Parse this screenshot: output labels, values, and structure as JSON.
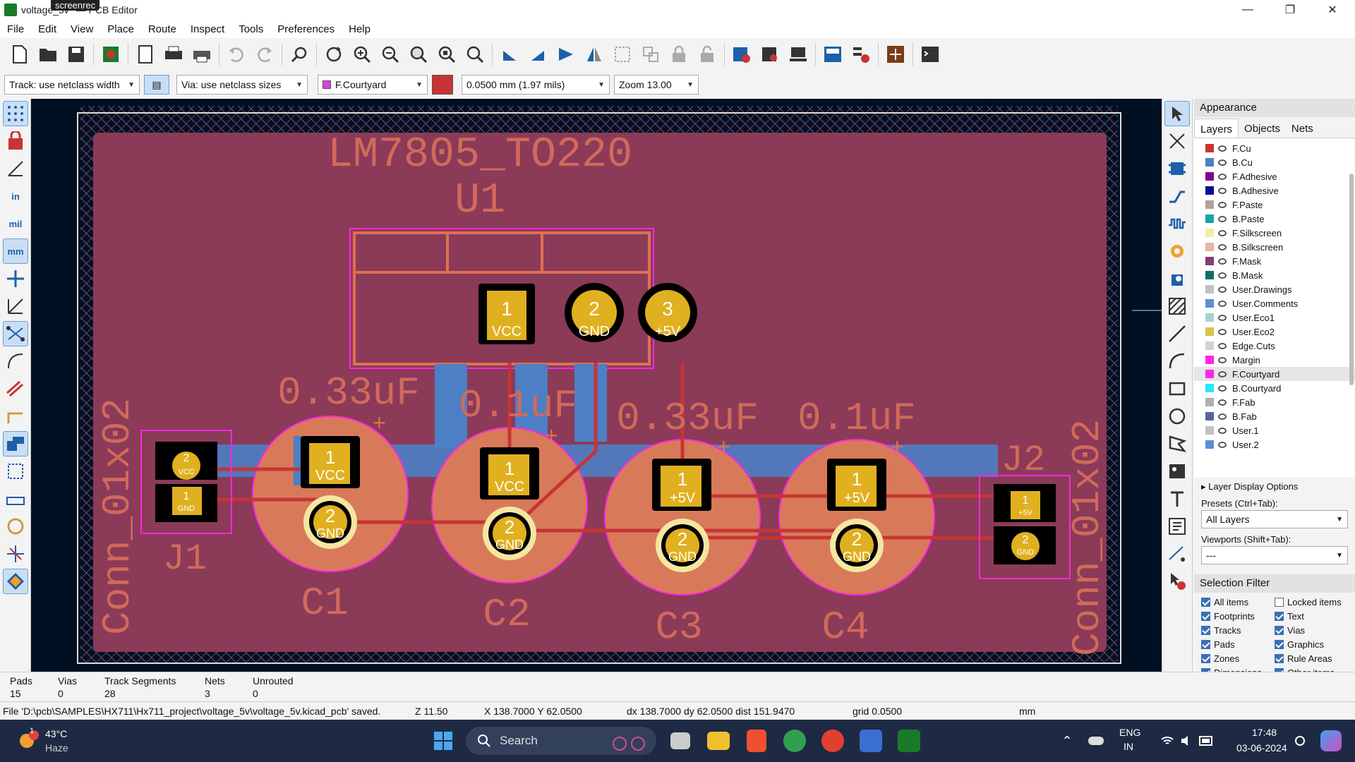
{
  "window": {
    "title_a": "voltage_5v",
    "title_b": "— PCB Editor",
    "recorder_badge": "screenrec"
  },
  "menu": [
    "File",
    "Edit",
    "View",
    "Place",
    "Route",
    "Inspect",
    "Tools",
    "Preferences",
    "Help"
  ],
  "auxbar": {
    "track": "Track: use netclass width",
    "via": "Via: use netclass sizes",
    "layer": "F.Courtyard",
    "grid": "0.0500 mm (1.97 mils)",
    "zoom": "Zoom 13.00"
  },
  "left_toolbar": {
    "in_label": "in",
    "mil_label": "mil",
    "mm_label": "mm"
  },
  "board": {
    "u1_value": "LM7805_TO220",
    "u1_ref": "U1",
    "u1_pads": [
      {
        "num": "1",
        "net": "VCC"
      },
      {
        "num": "2",
        "net": "GND"
      },
      {
        "num": "3",
        "net": "+5V"
      }
    ],
    "caps": [
      {
        "ref": "C1",
        "value": "0.33uF",
        "pad1": "VCC",
        "pad2": "GND"
      },
      {
        "ref": "C2",
        "value": "0.1uF",
        "pad1": "VCC",
        "pad2": "GND"
      },
      {
        "ref": "C3",
        "value": "0.33uF",
        "pad1": "+5V",
        "pad2": "GND"
      },
      {
        "ref": "C4",
        "value": "0.1uF",
        "pad1": "+5V",
        "pad2": "GND"
      }
    ],
    "j1_ref": "J1",
    "j2_ref": "J2",
    "conn_value": "Conn_01x02",
    "j1_pads": [
      {
        "num": "2",
        "net": "VCC"
      },
      {
        "num": "1",
        "net": "GND"
      }
    ],
    "j2_pads": [
      {
        "num": "1",
        "net": "+5V"
      },
      {
        "num": "2",
        "net": "GND"
      }
    ],
    "plus_sign": "+"
  },
  "appearance": {
    "title": "Appearance",
    "tabs": [
      "Layers",
      "Objects",
      "Nets"
    ],
    "layers": [
      {
        "name": "F.Cu",
        "color": "#c83434"
      },
      {
        "name": "B.Cu",
        "color": "#4d7fc4"
      },
      {
        "name": "F.Adhesive",
        "color": "#84008f"
      },
      {
        "name": "B.Adhesive",
        "color": "#0a0a8a"
      },
      {
        "name": "F.Paste",
        "color": "#b4a09a"
      },
      {
        "name": "B.Paste",
        "color": "#11a6a6"
      },
      {
        "name": "F.Silkscreen",
        "color": "#f2eda1"
      },
      {
        "name": "B.Silkscreen",
        "color": "#e8b2a7"
      },
      {
        "name": "F.Mask",
        "color": "#893c7a"
      },
      {
        "name": "B.Mask",
        "color": "#0e6e64"
      },
      {
        "name": "User.Drawings",
        "color": "#c2c2c2"
      },
      {
        "name": "User.Comments",
        "color": "#5a8fd6"
      },
      {
        "name": "User.Eco1",
        "color": "#a6d4cc"
      },
      {
        "name": "User.Eco2",
        "color": "#d6c44c"
      },
      {
        "name": "Edge.Cuts",
        "color": "#d0d2cd"
      },
      {
        "name": "Margin",
        "color": "#ff26e2"
      },
      {
        "name": "F.Courtyard",
        "color": "#ff26e2"
      },
      {
        "name": "B.Courtyard",
        "color": "#26e9ff"
      },
      {
        "name": "F.Fab",
        "color": "#afafaf"
      },
      {
        "name": "B.Fab",
        "color": "#58659a"
      },
      {
        "name": "User.1",
        "color": "#c2c2c2"
      },
      {
        "name": "User.2",
        "color": "#5a8fd6"
      }
    ],
    "selected_layer": "F.Courtyard",
    "layer_display_options": "Layer Display Options",
    "presets_label": "Presets (Ctrl+Tab):",
    "presets_value": "All Layers",
    "viewports_label": "Viewports (Shift+Tab):",
    "viewports_value": "---"
  },
  "selection_filter": {
    "title": "Selection Filter",
    "items": [
      {
        "label": "All items",
        "checked": true
      },
      {
        "label": "Locked items",
        "checked": false
      },
      {
        "label": "Footprints",
        "checked": true
      },
      {
        "label": "Text",
        "checked": true
      },
      {
        "label": "Tracks",
        "checked": true
      },
      {
        "label": "Vias",
        "checked": true
      },
      {
        "label": "Pads",
        "checked": true
      },
      {
        "label": "Graphics",
        "checked": true
      },
      {
        "label": "Zones",
        "checked": true
      },
      {
        "label": "Rule Areas",
        "checked": true
      },
      {
        "label": "Dimensions",
        "checked": true
      },
      {
        "label": "Other items",
        "checked": true
      }
    ]
  },
  "message_panel": [
    {
      "label": "Pads",
      "value": "15"
    },
    {
      "label": "Vias",
      "value": "0"
    },
    {
      "label": "Track Segments",
      "value": "28"
    },
    {
      "label": "Nets",
      "value": "3"
    },
    {
      "label": "Unrouted",
      "value": "0"
    }
  ],
  "status_bar": {
    "message": "File 'D:\\pcb\\SAMPLES\\HX711\\Hx711_project\\voltage_5v\\voltage_5v.kicad_pcb' saved.",
    "zoom": "Z 11.50",
    "xy": "X 138.7000  Y 62.0500",
    "delta": "dx 138.7000  dy 62.0500  dist 151.9470",
    "grid": "grid 0.0500",
    "units": "mm"
  },
  "taskbar": {
    "temp": "43°C",
    "weather": "Haze",
    "weather_badge": "1",
    "search": "Search",
    "lang1": "ENG",
    "lang2": "IN",
    "time": "17:48",
    "date": "03-06-2024"
  }
}
